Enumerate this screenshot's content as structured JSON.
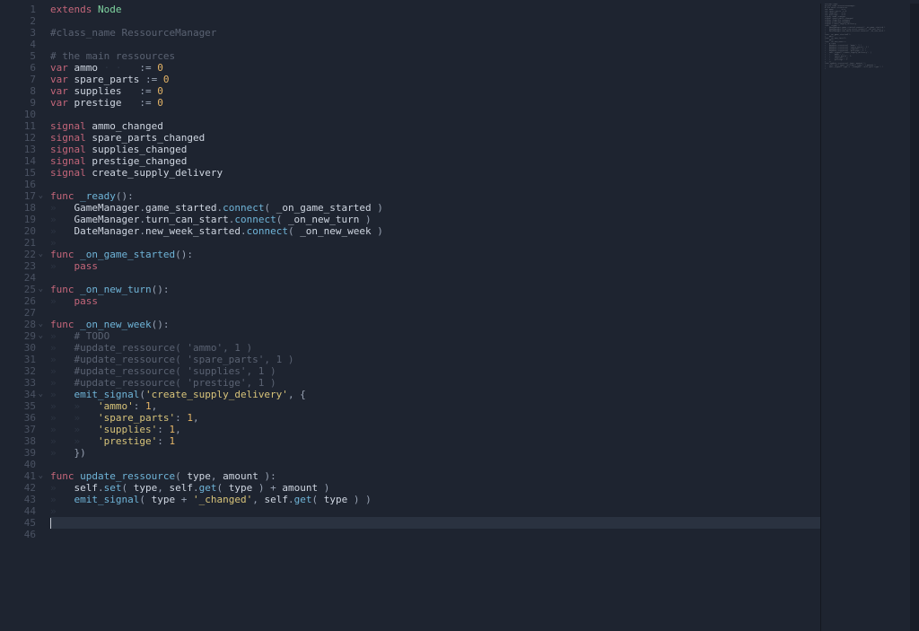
{
  "editor": {
    "cursor_line": 45,
    "arrow_line": 17,
    "fold_lines": [
      17,
      22,
      25,
      28,
      29,
      34,
      41
    ],
    "lines": [
      {
        "n": 1,
        "tokens": [
          [
            "kw",
            "extends"
          ],
          [
            "op",
            " "
          ],
          [
            "type",
            "Node"
          ]
        ]
      },
      {
        "n": 2,
        "tokens": []
      },
      {
        "n": 3,
        "tokens": [
          [
            "cmt",
            "#class_name RessourceManager"
          ]
        ]
      },
      {
        "n": 4,
        "tokens": []
      },
      {
        "n": 5,
        "tokens": [
          [
            "cmt",
            "# the main ressources"
          ]
        ]
      },
      {
        "n": 6,
        "tokens": [
          [
            "kw",
            "var"
          ],
          [
            "op",
            " "
          ],
          [
            "ident",
            "ammo"
          ],
          [
            "ws",
            " · ·   "
          ],
          [
            "op",
            ":= "
          ],
          [
            "num",
            "0"
          ]
        ]
      },
      {
        "n": 7,
        "tokens": [
          [
            "kw",
            "var"
          ],
          [
            "op",
            " "
          ],
          [
            "ident",
            "spare_parts"
          ],
          [
            "op",
            " := "
          ],
          [
            "num",
            "0"
          ]
        ]
      },
      {
        "n": 8,
        "tokens": [
          [
            "kw",
            "var"
          ],
          [
            "op",
            " "
          ],
          [
            "ident",
            "supplies"
          ],
          [
            "ws",
            "   "
          ],
          [
            "op",
            ":= "
          ],
          [
            "num",
            "0"
          ]
        ]
      },
      {
        "n": 9,
        "tokens": [
          [
            "kw",
            "var"
          ],
          [
            "op",
            " "
          ],
          [
            "ident",
            "prestige"
          ],
          [
            "ws",
            "   "
          ],
          [
            "op",
            ":= "
          ],
          [
            "num",
            "0"
          ]
        ]
      },
      {
        "n": 10,
        "tokens": []
      },
      {
        "n": 11,
        "tokens": [
          [
            "kw",
            "signal"
          ],
          [
            "op",
            " "
          ],
          [
            "ident",
            "ammo_changed"
          ]
        ]
      },
      {
        "n": 12,
        "tokens": [
          [
            "kw",
            "signal"
          ],
          [
            "op",
            " "
          ],
          [
            "ident",
            "spare_parts_changed"
          ]
        ]
      },
      {
        "n": 13,
        "tokens": [
          [
            "kw",
            "signal"
          ],
          [
            "op",
            " "
          ],
          [
            "ident",
            "supplies_changed"
          ]
        ]
      },
      {
        "n": 14,
        "tokens": [
          [
            "kw",
            "signal"
          ],
          [
            "op",
            " "
          ],
          [
            "ident",
            "prestige_changed"
          ]
        ]
      },
      {
        "n": 15,
        "tokens": [
          [
            "kw",
            "signal"
          ],
          [
            "op",
            " "
          ],
          [
            "ident",
            "create_supply_delivery"
          ]
        ]
      },
      {
        "n": 16,
        "tokens": []
      },
      {
        "n": 17,
        "tokens": [
          [
            "kw",
            "func"
          ],
          [
            "op",
            " "
          ],
          [
            "fn",
            "_ready"
          ],
          [
            "op",
            "():"
          ]
        ]
      },
      {
        "n": 18,
        "tokens": [
          [
            "ws",
            "»   "
          ],
          [
            "ident",
            "GameManager"
          ],
          [
            "op",
            "."
          ],
          [
            "ident",
            "game_started"
          ],
          [
            "op",
            "."
          ],
          [
            "fn",
            "connect"
          ],
          [
            "op",
            "( "
          ],
          [
            "ident",
            "_on_game_started"
          ],
          [
            "op",
            " )"
          ]
        ]
      },
      {
        "n": 19,
        "tokens": [
          [
            "ws",
            "»   "
          ],
          [
            "ident",
            "GameManager"
          ],
          [
            "op",
            "."
          ],
          [
            "ident",
            "turn_can_start"
          ],
          [
            "op",
            "."
          ],
          [
            "fn",
            "connect"
          ],
          [
            "op",
            "( "
          ],
          [
            "ident",
            "_on_new_turn"
          ],
          [
            "op",
            " )"
          ]
        ]
      },
      {
        "n": 20,
        "tokens": [
          [
            "ws",
            "»   "
          ],
          [
            "ident",
            "DateManager"
          ],
          [
            "op",
            "."
          ],
          [
            "ident",
            "new_week_started"
          ],
          [
            "op",
            "."
          ],
          [
            "fn",
            "connect"
          ],
          [
            "op",
            "( "
          ],
          [
            "ident",
            "_on_new_week"
          ],
          [
            "op",
            " )"
          ]
        ]
      },
      {
        "n": 21,
        "tokens": [
          [
            "ws",
            "»"
          ]
        ]
      },
      {
        "n": 22,
        "tokens": [
          [
            "kw",
            "func"
          ],
          [
            "op",
            " "
          ],
          [
            "fn",
            "_on_game_started"
          ],
          [
            "op",
            "():"
          ]
        ]
      },
      {
        "n": 23,
        "tokens": [
          [
            "ws",
            "»   "
          ],
          [
            "kw",
            "pass"
          ]
        ]
      },
      {
        "n": 24,
        "tokens": []
      },
      {
        "n": 25,
        "tokens": [
          [
            "kw",
            "func"
          ],
          [
            "op",
            " "
          ],
          [
            "fn",
            "_on_new_turn"
          ],
          [
            "op",
            "():"
          ]
        ]
      },
      {
        "n": 26,
        "tokens": [
          [
            "ws",
            "»   "
          ],
          [
            "kw",
            "pass"
          ]
        ]
      },
      {
        "n": 27,
        "tokens": []
      },
      {
        "n": 28,
        "tokens": [
          [
            "kw",
            "func"
          ],
          [
            "op",
            " "
          ],
          [
            "fn",
            "_on_new_week"
          ],
          [
            "op",
            "():"
          ]
        ]
      },
      {
        "n": 29,
        "tokens": [
          [
            "ws",
            "»   "
          ],
          [
            "cmt",
            "# TODO"
          ]
        ]
      },
      {
        "n": 30,
        "tokens": [
          [
            "ws",
            "»   "
          ],
          [
            "cmt",
            "#update_ressource( 'ammo', 1 )"
          ]
        ]
      },
      {
        "n": 31,
        "tokens": [
          [
            "ws",
            "»   "
          ],
          [
            "cmt",
            "#update_ressource( 'spare_parts', 1 )"
          ]
        ]
      },
      {
        "n": 32,
        "tokens": [
          [
            "ws",
            "»   "
          ],
          [
            "cmt",
            "#update_ressource( 'supplies', 1 )"
          ]
        ]
      },
      {
        "n": 33,
        "tokens": [
          [
            "ws",
            "»   "
          ],
          [
            "cmt",
            "#update_ressource( 'prestige', 1 )"
          ]
        ]
      },
      {
        "n": 34,
        "tokens": [
          [
            "ws",
            "»   "
          ],
          [
            "fn",
            "emit_signal"
          ],
          [
            "op",
            "("
          ],
          [
            "str",
            "'create_supply_delivery'"
          ],
          [
            "op",
            ", {"
          ]
        ]
      },
      {
        "n": 35,
        "tokens": [
          [
            "ws",
            "»   »   "
          ],
          [
            "str",
            "'ammo'"
          ],
          [
            "op",
            ": "
          ],
          [
            "num",
            "1"
          ],
          [
            "op",
            ","
          ]
        ]
      },
      {
        "n": 36,
        "tokens": [
          [
            "ws",
            "»   »   "
          ],
          [
            "str",
            "'spare_parts'"
          ],
          [
            "op",
            ": "
          ],
          [
            "num",
            "1"
          ],
          [
            "op",
            ","
          ]
        ]
      },
      {
        "n": 37,
        "tokens": [
          [
            "ws",
            "»   »   "
          ],
          [
            "str",
            "'supplies'"
          ],
          [
            "op",
            ": "
          ],
          [
            "num",
            "1"
          ],
          [
            "op",
            ","
          ]
        ]
      },
      {
        "n": 38,
        "tokens": [
          [
            "ws",
            "»   »   "
          ],
          [
            "str",
            "'prestige'"
          ],
          [
            "op",
            ": "
          ],
          [
            "num",
            "1"
          ]
        ]
      },
      {
        "n": 39,
        "tokens": [
          [
            "ws",
            "»   "
          ],
          [
            "op",
            "})"
          ]
        ]
      },
      {
        "n": 40,
        "tokens": []
      },
      {
        "n": 41,
        "tokens": [
          [
            "kw",
            "func"
          ],
          [
            "op",
            " "
          ],
          [
            "fn",
            "update_ressource"
          ],
          [
            "op",
            "( "
          ],
          [
            "ident",
            "type"
          ],
          [
            "op",
            ", "
          ],
          [
            "ident",
            "amount"
          ],
          [
            "op",
            " ):"
          ]
        ]
      },
      {
        "n": 42,
        "tokens": [
          [
            "ws",
            "»   "
          ],
          [
            "ident",
            "self"
          ],
          [
            "op",
            "."
          ],
          [
            "fn",
            "set"
          ],
          [
            "op",
            "( "
          ],
          [
            "ident",
            "type"
          ],
          [
            "op",
            ", "
          ],
          [
            "ident",
            "self"
          ],
          [
            "op",
            "."
          ],
          [
            "fn",
            "get"
          ],
          [
            "op",
            "( "
          ],
          [
            "ident",
            "type"
          ],
          [
            "op",
            " ) + "
          ],
          [
            "ident",
            "amount"
          ],
          [
            "op",
            " )"
          ]
        ]
      },
      {
        "n": 43,
        "tokens": [
          [
            "ws",
            "»   "
          ],
          [
            "fn",
            "emit_signal"
          ],
          [
            "op",
            "( "
          ],
          [
            "ident",
            "type"
          ],
          [
            "op",
            " + "
          ],
          [
            "str",
            "'_changed'"
          ],
          [
            "op",
            ", "
          ],
          [
            "ident",
            "self"
          ],
          [
            "op",
            "."
          ],
          [
            "fn",
            "get"
          ],
          [
            "op",
            "( "
          ],
          [
            "ident",
            "type"
          ],
          [
            "op",
            " ) )"
          ]
        ]
      },
      {
        "n": 44,
        "tokens": [
          [
            "ws",
            "»"
          ]
        ]
      },
      {
        "n": 45,
        "tokens": []
      },
      {
        "n": 46,
        "tokens": []
      }
    ]
  }
}
